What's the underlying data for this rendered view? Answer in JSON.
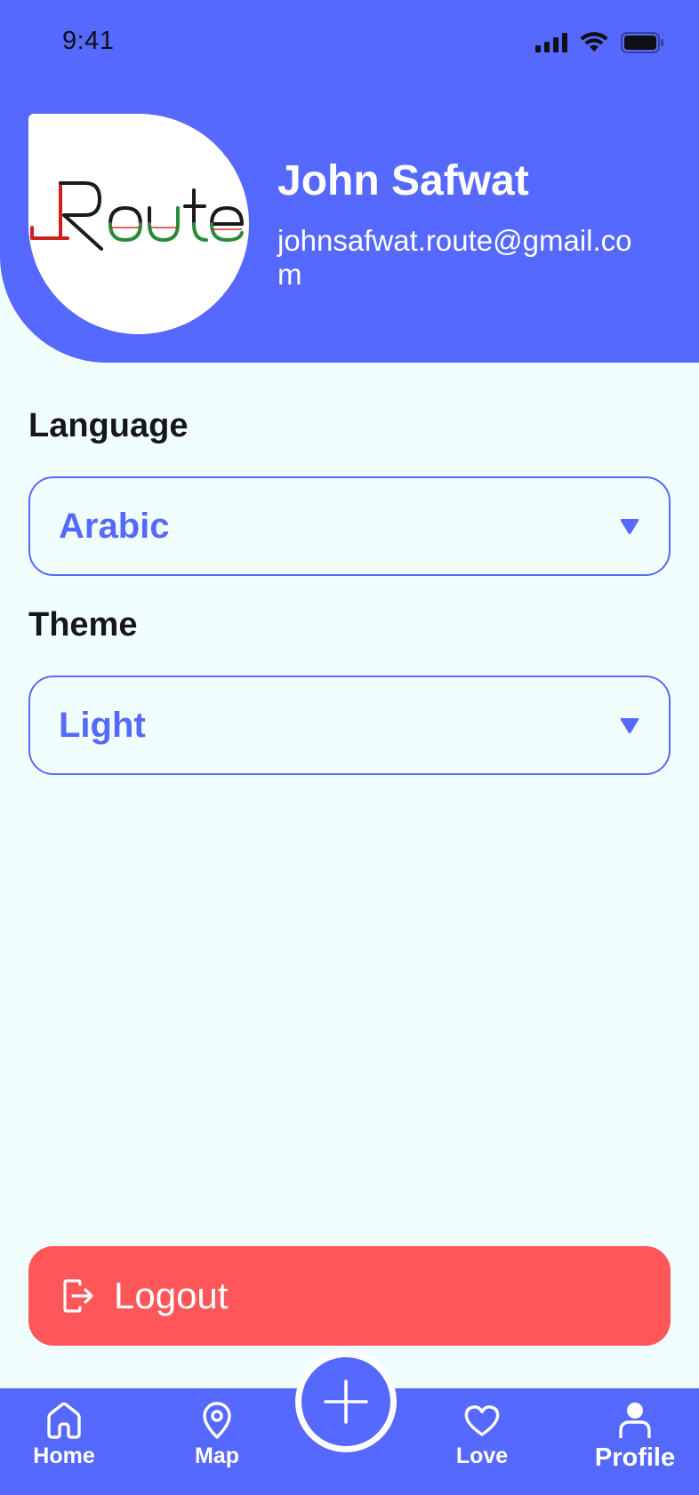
{
  "status_bar": {
    "time": "9:41",
    "icons": [
      "signal-icon",
      "wifi-icon",
      "battery-icon"
    ]
  },
  "profile": {
    "name": "John Safwat",
    "email": "johnsafwat.route@gmail.com",
    "avatar_logo_text": "Route"
  },
  "settings": {
    "language_label": "Language",
    "language_value": "Arabic",
    "theme_label": "Theme",
    "theme_value": "Light"
  },
  "logout": {
    "label": "Logout",
    "icon": "logout-icon"
  },
  "bottom_nav": {
    "items": [
      {
        "label": "Home",
        "icon": "home-icon"
      },
      {
        "label": "Map",
        "icon": "map-pin-icon"
      },
      {
        "label": "Love",
        "icon": "heart-icon"
      },
      {
        "label": "Profile",
        "icon": "person-icon",
        "active": true
      }
    ],
    "fab_icon": "plus-icon"
  },
  "colors": {
    "primary": "#5669FF",
    "background": "#F0FFFE",
    "logout": "#FF5659",
    "text_dark": "#16161C"
  }
}
